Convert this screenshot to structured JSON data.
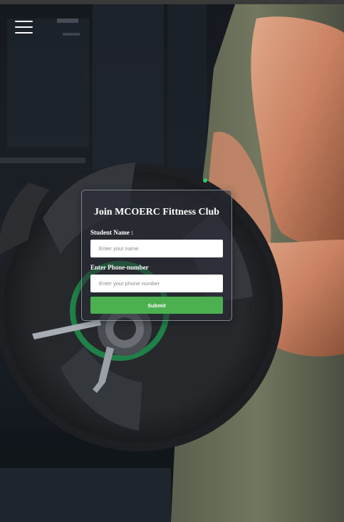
{
  "nav": {
    "menu_icon": "hamburger-menu-icon"
  },
  "form": {
    "title": "Join MCOERC Fittness Club",
    "name_label": "Student Name :",
    "name_placeholder": "Enter your name",
    "phone_label": "Enter Phone-number",
    "phone_placeholder": "Enter your phone number",
    "submit_label": "Submit"
  },
  "colors": {
    "accent": "#4caf50",
    "field_bg": "#ffffff",
    "title_text": "#ffffff"
  }
}
